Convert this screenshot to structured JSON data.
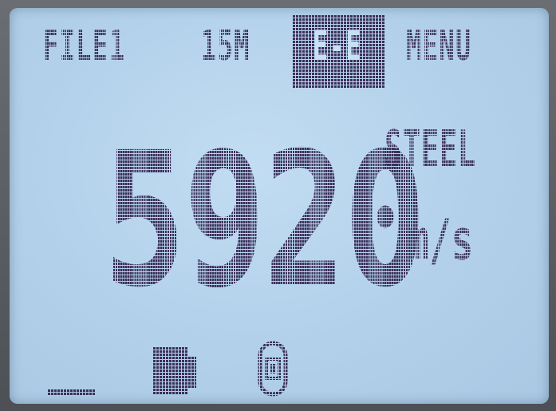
{
  "header": {
    "file": "FILE1",
    "range": "15M",
    "mode": "E-E",
    "menu": "MENU"
  },
  "reading": {
    "value": "5920",
    "material": "STEEL",
    "unit": "m/s"
  },
  "status_icons": [
    "dash-icon",
    "battery-icon",
    "coupling-icon"
  ],
  "colors": {
    "lcd_background": "#b6d3ec",
    "segment": "#3b2f5a"
  }
}
